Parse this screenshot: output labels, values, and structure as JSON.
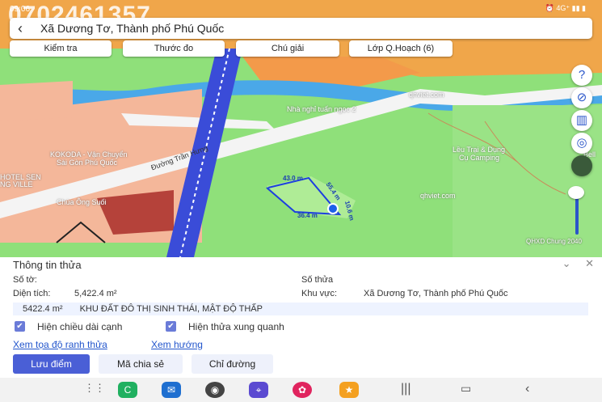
{
  "status": {
    "time": "09:06",
    "icons": "⏰ 4G⁺ ▮▮ ▮"
  },
  "watermark": "0702461357",
  "search": {
    "title": "Xã Dương Tơ, Thành phố Phú Quốc"
  },
  "toolbar": {
    "check_label": "Kiểm tra",
    "measure_label": "Thước đo",
    "legend_label": "Chú giải",
    "layers_label": "Lớp Q.Hoạch (6)"
  },
  "map": {
    "label_nha_nghi": "Nhà nghỉ tuấn ngọc 2",
    "label_kokoda": "KOKODA - Vận Chuyển",
    "label_saigon": "Sài Gòn Phú Quốc",
    "label_hotel": "HOTEL SEN",
    "label_ville": "NG VILLE",
    "label_chua": "Chùa Ông Suối",
    "label_road": "Đường Trần Hưng",
    "label_luu_trai": "Lều Trại & Dụng",
    "label_camping": "Cụ Camping",
    "label_qhviet1": "qhviet.com",
    "label_qhviet2": "qhviet.com",
    "label_bell": "Bell",
    "scale": "QHXD Chung 2040",
    "dim_top": "43.0 m",
    "dim_right": "55.4 m",
    "dim_bottom": "36.4 m",
    "dim_small": "10.6 m"
  },
  "panel": {
    "title": "Thông tin thửa",
    "so_to_label": "Số tờ:",
    "so_thua_label": "Số thửa",
    "dien_tich_label": "Diện tích:",
    "dien_tich_value": "5,422.4 m²",
    "khu_vuc_label": "Khu vực:",
    "khu_vuc_value": "Xã Dương Tơ, Thành phố Phú Quốc",
    "zone_area": "5422.4 m²",
    "zone_name": "KHU ĐẤT ĐÔ THỊ SINH THÁI, MẬT ĐỘ THẤP",
    "chk1_label": "Hiện chiều dài cạnh",
    "chk2_label": "Hiện thửa xung quanh",
    "link_coords": "Xem tọa độ ranh thửa",
    "link_direction": "Xem hướng",
    "btn_save": "Lưu điểm",
    "btn_share": "Mã chia sẻ",
    "btn_route": "Chỉ đường"
  },
  "side_buttons": {
    "help": "?",
    "compass": "⊘",
    "barcode": "▥",
    "locate": "◎"
  }
}
